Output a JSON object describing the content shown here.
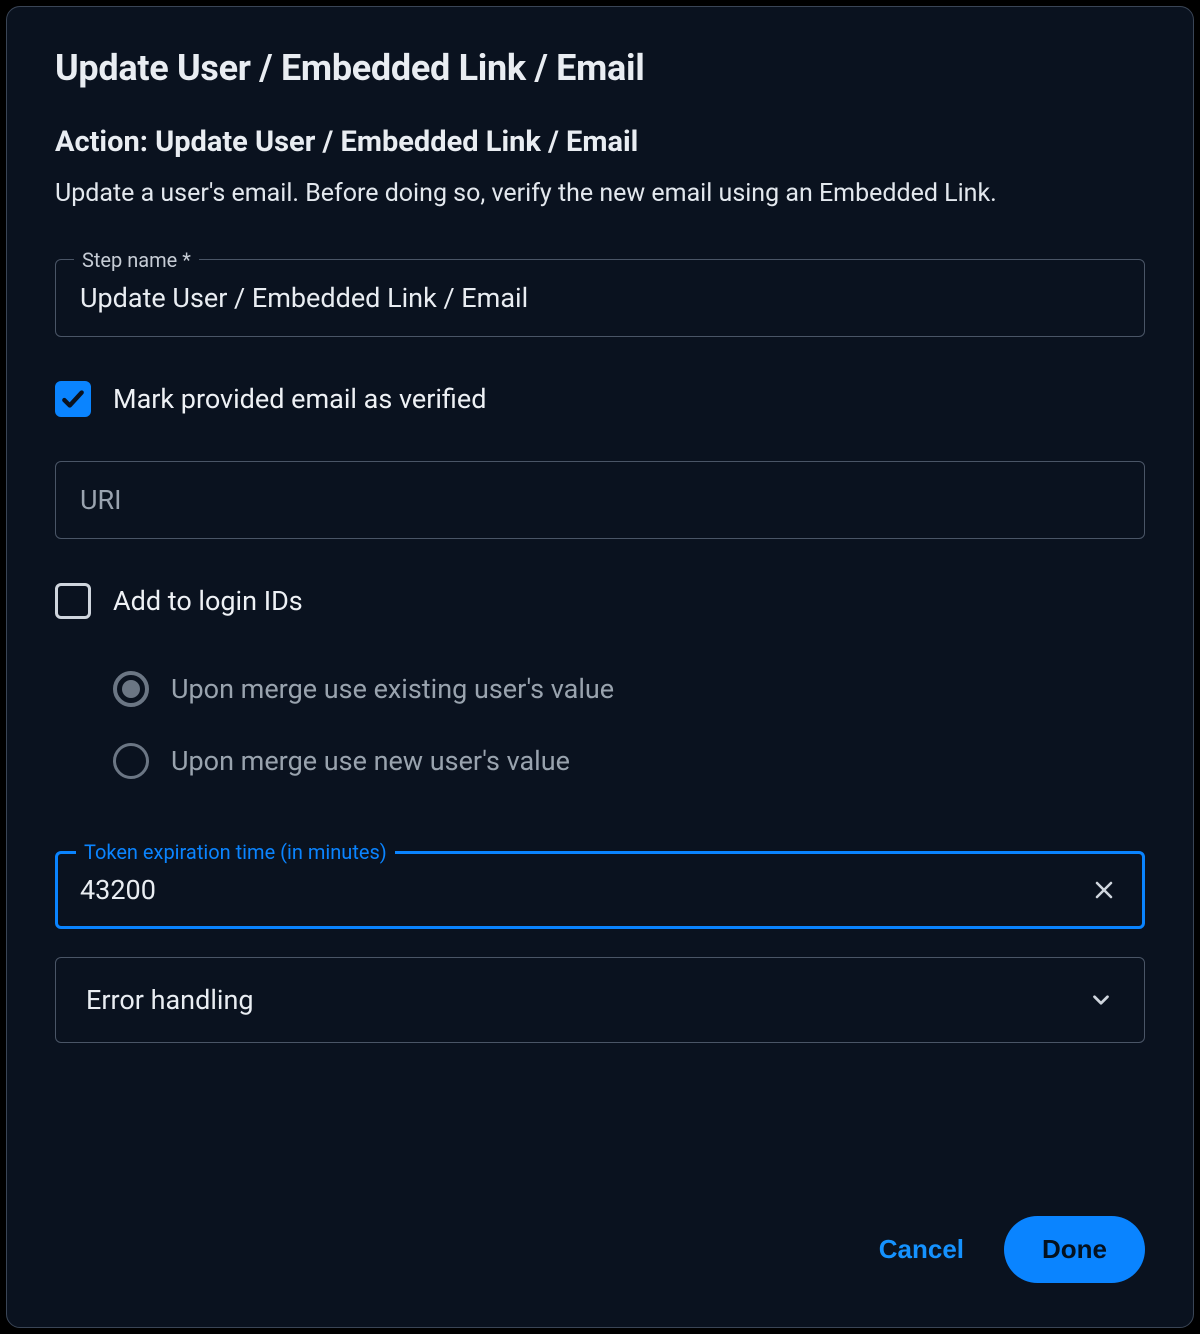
{
  "header": {
    "title": "Update User / Embedded Link / Email",
    "subtitle": "Action: Update User / Embedded Link / Email",
    "description": "Update a user's email. Before doing so, verify the new email using an Embedded Link."
  },
  "fields": {
    "step_name": {
      "label": "Step name *",
      "value": "Update User / Embedded Link / Email"
    },
    "verified_checkbox": {
      "label": "Mark provided email as verified",
      "checked": true
    },
    "uri_input": {
      "placeholder": "URI",
      "value": ""
    },
    "login_ids_checkbox": {
      "label": "Add to login IDs",
      "checked": false
    },
    "merge_radio": {
      "options": [
        {
          "label": "Upon merge use existing user's value",
          "selected": true
        },
        {
          "label": "Upon merge use new user's value",
          "selected": false
        }
      ]
    },
    "token_expiration": {
      "label": "Token expiration time (in minutes)",
      "value": "43200"
    },
    "error_handling": {
      "label": "Error handling"
    }
  },
  "buttons": {
    "cancel": "Cancel",
    "done": "Done"
  }
}
